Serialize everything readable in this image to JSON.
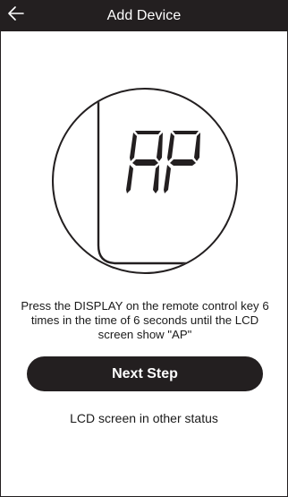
{
  "header": {
    "title": "Add Device",
    "back_icon": "arrow-left-icon"
  },
  "display": {
    "lcd_text": "AP"
  },
  "instruction": {
    "text": "Press the DISPLAY on the remote control key 6 times in the time of 6 seconds until the LCD screen show \"AP\""
  },
  "actions": {
    "next_step_label": "Next Step",
    "other_status_label": "LCD screen in other status"
  },
  "colors": {
    "header_bg": "#231f20",
    "button_bg": "#231f20",
    "text": "#1a1a1a",
    "background": "#ffffff"
  }
}
